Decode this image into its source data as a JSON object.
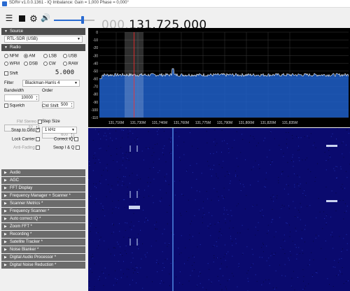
{
  "window": {
    "title": "SDR# v1.0.0.1361 - IQ Imbalance: Gain = 1,000 Phase = 0,000°"
  },
  "toolbar": {
    "menu_icon": "hamburger-menu-icon",
    "stop_icon": "stop-icon",
    "settings_icon": "gear-icon",
    "audio_icon": "speaker-icon",
    "volume": 0.7,
    "frequency_prefix": "000.",
    "frequency_main": "131.725.000"
  },
  "source": {
    "header": "Source",
    "device": "RTL-SDR (USB)"
  },
  "radio": {
    "header": "Radio",
    "modes": [
      "NFM",
      "AM",
      "LSB",
      "USB",
      "WFM",
      "DSB",
      "CW",
      "RAW"
    ],
    "selected_mode": "AM",
    "shift_label": "Shift",
    "shift_value": "5.000",
    "filter_label": "Filter",
    "filter_value": "Blackman-Harris 4",
    "bandwidth_label": "Bandwidth",
    "bandwidth_value": "10000",
    "order_label": "Order",
    "order_value": "500",
    "squelch_label": "Squelch",
    "squelch_value": "32",
    "cw_shift_label": "CW Shift",
    "cw_shift_value": "600",
    "fm_stereo_label": "FM Stereo",
    "step_size_label": "Step Size",
    "snap_to_grid_label": "Snap to Grid",
    "snap_to_grid_checked": true,
    "step_size_value": "1 kHz",
    "lock_carrier_label": "Lock Carrier",
    "correct_iq_label": "Correct IQ",
    "anti_fading_label": "Anti-Fading",
    "swap_iq_label": "Swap I & Q"
  },
  "collapsed_sections": [
    "Audio",
    "AGC",
    "FFT Display",
    "Frequency Manager + Scanner *",
    "Scanner Metrics *",
    "Frequency Scanner *",
    "Auto correct IQ *",
    "Zoom FFT *",
    "Recording *",
    "Satellite Tracker *",
    "Noise Blanker *",
    "Digital Audio Processor *",
    "Digital Noise Reduction *"
  ],
  "spectrum": {
    "y_axis_labels": [
      "0",
      "-10",
      "-20",
      "-30",
      "-40",
      "-50",
      "-60",
      "-70",
      "-80",
      "-90",
      "-100",
      "-110"
    ],
    "x_axis_labels": [
      "131,716M",
      "131,730M",
      "131,746M",
      "131,760M",
      "131,775M",
      "131,790M",
      "131,806M",
      "131,820M",
      "131,835M"
    ],
    "trace_color": "#ffffff",
    "fill_color": "#1e5fc9",
    "vfo_marker_color": "#ff2a2a"
  },
  "waterfall": {
    "background_color": "#0a0a6e"
  }
}
